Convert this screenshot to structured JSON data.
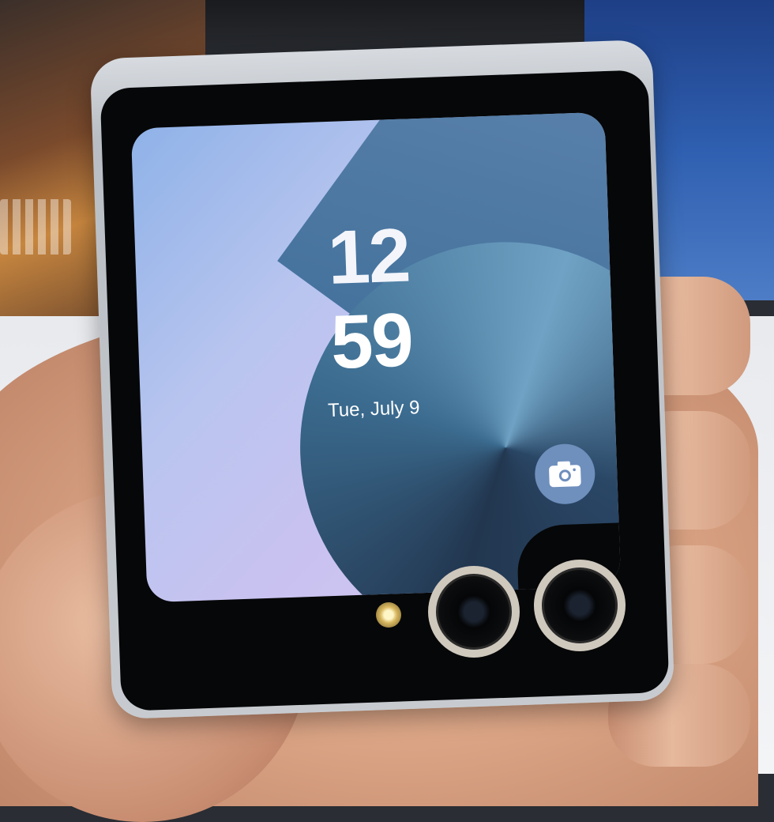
{
  "lock_screen": {
    "hour": "12",
    "minute": "59",
    "date": "Tue, July 9"
  },
  "icons": {
    "camera_shortcut": "camera-icon"
  },
  "colors": {
    "screen_light": "#c8c2f0",
    "screen_dark": "#22364f",
    "camera_button": "#6f8fbd",
    "lens_ring": "#cfc8bd",
    "phone_frame": "#c7cbd0"
  }
}
